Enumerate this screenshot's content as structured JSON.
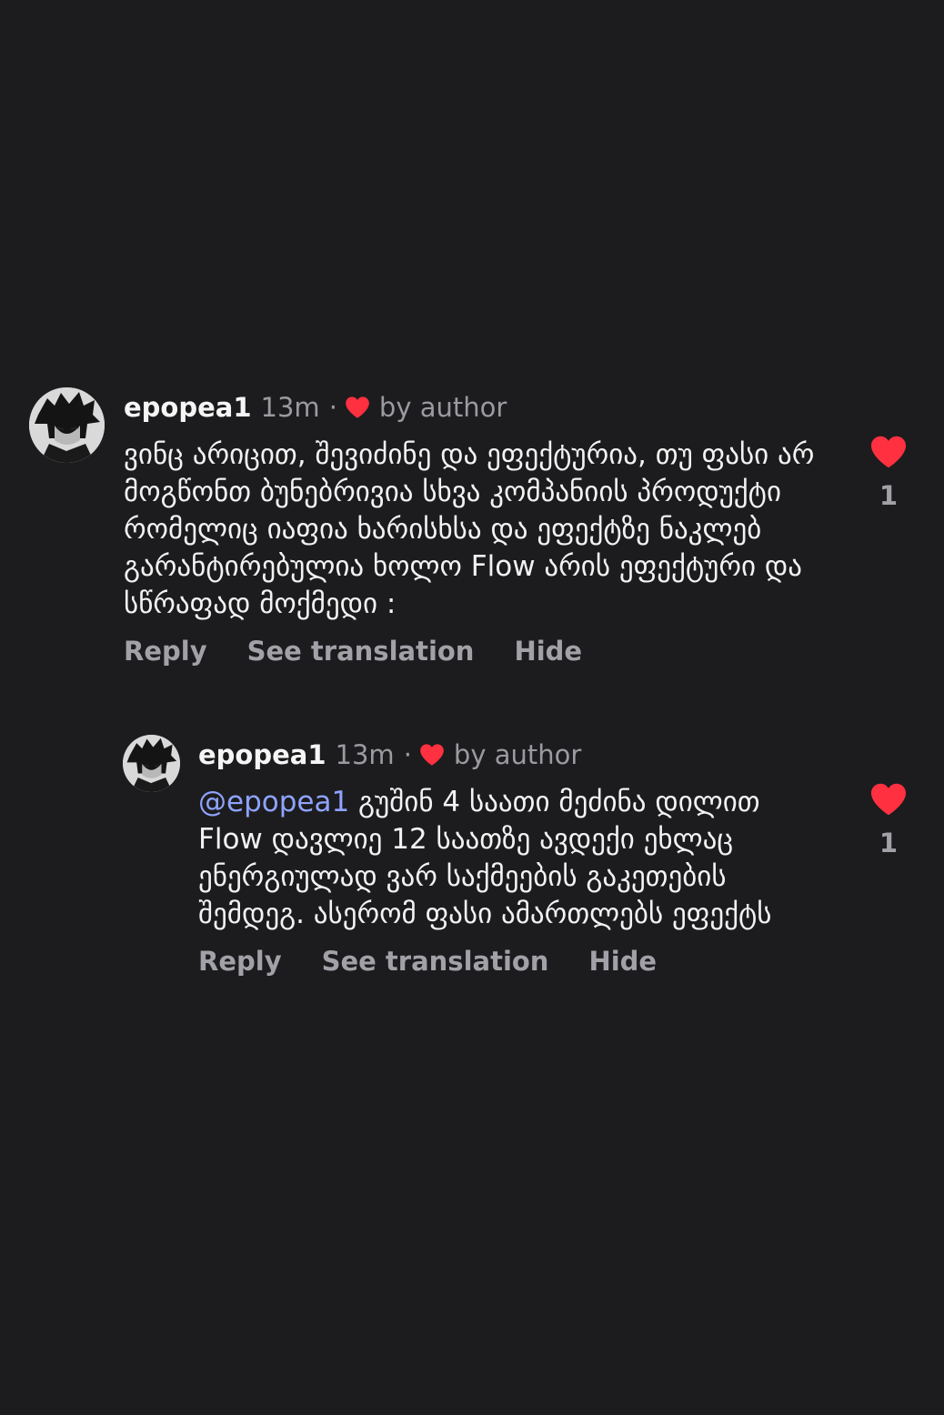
{
  "colors": {
    "background": "#1c1c1e",
    "heart": "#ff3040",
    "mention": "#8fa3ff",
    "secondary_text": "#9a9aa0"
  },
  "comments": [
    {
      "username": "epopea1",
      "time": "13m",
      "separator": "·",
      "by_author": "by author",
      "text": "ვინც არიცით, შევიძინე და ეფექტურია, თუ ფასი არ მოგწონთ ბუნებრივია სხვა კომპანიის პროდუქტი რომელიც იაფია ხარისხსა და ეფექტზე ნაკლებ გარანტირებულია ხოლო Flow არის ეფექტური და სწრაფად მოქმედი :",
      "actions": {
        "reply": "Reply",
        "see_translation": "See translation",
        "hide": "Hide"
      },
      "like_count": "1",
      "avatar_icon": "anime-avatar-icon",
      "liked_icon": "heart-filled-icon"
    },
    {
      "username": "epopea1",
      "time": "13m",
      "separator": "·",
      "by_author": "by author",
      "mention": "@epopea1",
      "text": " გუშინ 4 საათი მეძინა დილით Flow დავლიე 12 საათზე ავდექი ეხლაც ენერგიულად ვარ საქმეების გაკეთების შემდეგ. ასერომ ფასი ამართლებს ეფექტს",
      "actions": {
        "reply": "Reply",
        "see_translation": "See translation",
        "hide": "Hide"
      },
      "like_count": "1",
      "avatar_icon": "anime-avatar-icon",
      "liked_icon": "heart-filled-icon"
    }
  ]
}
